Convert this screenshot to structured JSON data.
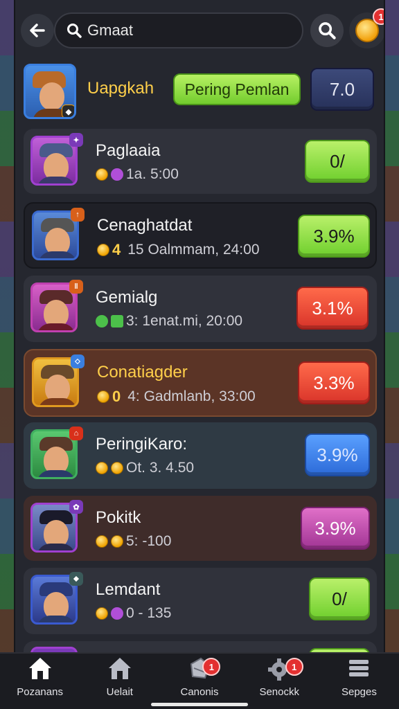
{
  "header": {
    "search_value": "Gmaat",
    "notif_count": "1"
  },
  "top_entry": {
    "name": "Uapgkah",
    "tag": "Pering Pemlan",
    "score": "7.0"
  },
  "rows": [
    {
      "name": "Paglaaia",
      "meta_num": "",
      "meta": "1a. 5:00",
      "badge": "0/"
    },
    {
      "name": "Cenaghatdat",
      "meta_num": "4",
      "meta": "15 Oalmmam, 24:00",
      "badge": "3.9%"
    },
    {
      "name": "Gemialg",
      "meta_num": "",
      "meta": "3: 1enat.mi, 20:00",
      "badge": "3.1%"
    },
    {
      "name": "Conatiagder",
      "meta_num": "0",
      "meta": "4: Gadmlanb, 33:00",
      "badge": "3.3%"
    },
    {
      "name": "PeringiKaro:",
      "meta_num": "",
      "meta": "Ot. 3. 4.50",
      "badge": "3.9%"
    },
    {
      "name": "Pokitk",
      "meta_num": "",
      "meta": "5: -100",
      "badge": "3.9%"
    },
    {
      "name": "Lemdant",
      "meta_num": "",
      "meta": "0 - 135",
      "badge": "0/"
    }
  ],
  "nav": [
    {
      "label": "Pozanans",
      "icon": "home-icon"
    },
    {
      "label": "Uelait",
      "icon": "house-icon"
    },
    {
      "label": "Canonis",
      "icon": "gift-icon",
      "badge": "1"
    },
    {
      "label": "Senockk",
      "icon": "gear-icon",
      "badge": "1"
    },
    {
      "label": "Sepges",
      "icon": "stack-icon"
    }
  ]
}
